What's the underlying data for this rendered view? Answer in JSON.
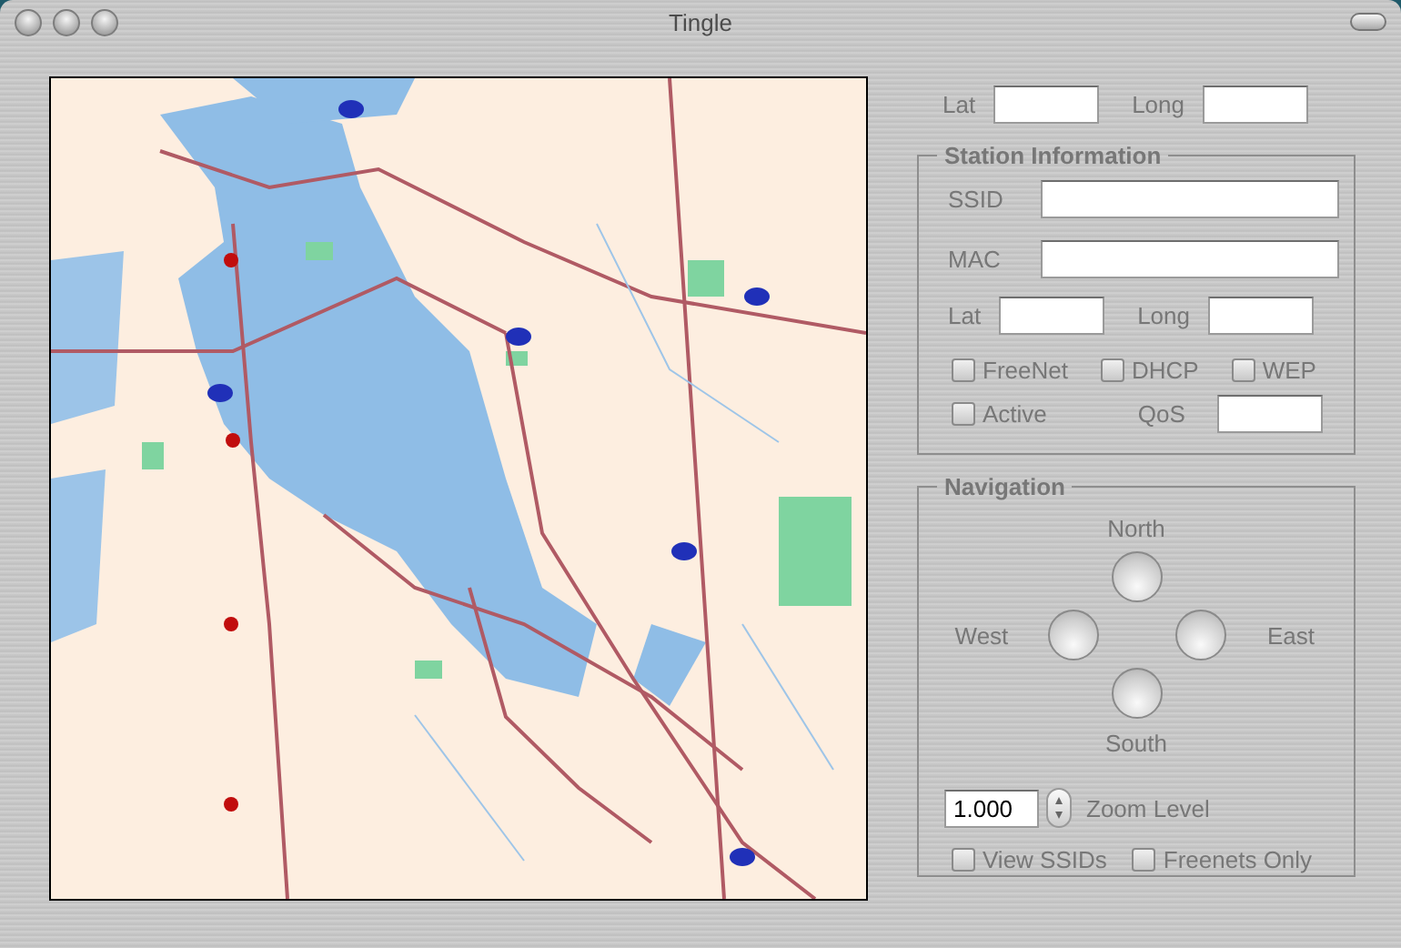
{
  "window": {
    "title": "Tingle"
  },
  "location": [
    {
      "label": "Lat"
    },
    {
      "label": "Long"
    }
  ],
  "station_information": {
    "title": "Station Information",
    "fields": [
      {
        "label": "SSID"
      },
      {
        "label": "MAC"
      }
    ],
    "location": [
      {
        "label": "Lat"
      },
      {
        "label": "Long"
      }
    ],
    "options": [
      {
        "label": "FreeNet",
        "checked": false
      },
      {
        "label": "DHCP",
        "checked": false
      },
      {
        "label": "WEP",
        "checked": false
      },
      {
        "label": "Active",
        "checked": false
      }
    ],
    "qos": {
      "label": "QoS"
    }
  },
  "navigation": {
    "title": "Navigation",
    "directions": [
      {
        "kind": "north",
        "label": "North"
      },
      {
        "kind": "west",
        "label": "West"
      },
      {
        "kind": "east",
        "label": "East"
      },
      {
        "kind": "south",
        "label": "South"
      }
    ],
    "zoom": {
      "value": "1.000",
      "label": "Zoom Level"
    },
    "options": [
      {
        "label": "View SSIDs",
        "checked": false
      },
      {
        "label": "Freenets Only",
        "checked": false
      }
    ]
  }
}
